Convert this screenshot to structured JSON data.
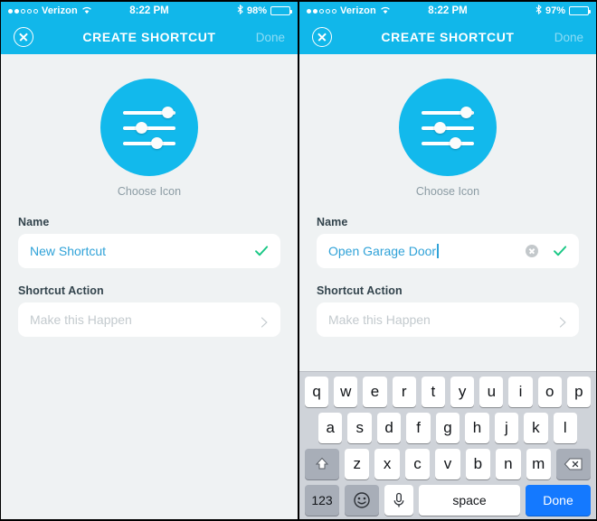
{
  "screens": [
    {
      "id": "left",
      "statusbar": {
        "signal_filled": 2,
        "signal_empty": 3,
        "carrier": "Verizon",
        "wifi_icon": "wifi-icon",
        "time": "8:22 PM",
        "bluetooth_icon": "bluetooth-icon",
        "battery_pct": "98%",
        "battery_level": 97
      },
      "navbar": {
        "close_icon": "close-circle-icon",
        "title": "CREATE SHORTCUT",
        "done_label": "Done"
      },
      "icon": {
        "choose_label": "Choose Icon",
        "circle_color": "#12b9ec",
        "slider_positions": [
          96,
          32,
          70
        ]
      },
      "name_field": {
        "label": "Name",
        "value": "New Shortcut",
        "placeholder": "Name",
        "show_clear": false,
        "show_caret": false,
        "check_icon": "checkmark-icon",
        "check_color": "#18c784",
        "value_color": "#2fa2d8"
      },
      "action_field": {
        "label": "Shortcut Action",
        "placeholder": "Make this Happen",
        "chevron_icon": "chevron-right-icon"
      },
      "keyboard": {
        "visible": false
      }
    },
    {
      "id": "right",
      "statusbar": {
        "signal_filled": 2,
        "signal_empty": 3,
        "carrier": "Verizon",
        "wifi_icon": "wifi-icon",
        "time": "8:22 PM",
        "bluetooth_icon": "bluetooth-icon",
        "battery_pct": "97%",
        "battery_level": 95
      },
      "navbar": {
        "close_icon": "close-circle-icon",
        "title": "CREATE SHORTCUT",
        "done_label": "Done"
      },
      "icon": {
        "choose_label": "Choose Icon",
        "circle_color": "#12b9ec",
        "slider_positions": [
          96,
          32,
          70
        ]
      },
      "name_field": {
        "label": "Name",
        "value": "Open Garage Door",
        "placeholder": "Name",
        "show_clear": true,
        "show_caret": true,
        "clear_icon": "clear-text-icon",
        "check_icon": "checkmark-icon",
        "check_color": "#18c784",
        "value_color": "#2fa2d8"
      },
      "action_field": {
        "label": "Shortcut Action",
        "placeholder": "Make this Happen",
        "chevron_icon": "chevron-right-icon"
      },
      "keyboard": {
        "visible": true,
        "row1": [
          "q",
          "w",
          "e",
          "r",
          "t",
          "y",
          "u",
          "i",
          "o",
          "p"
        ],
        "row2": [
          "a",
          "s",
          "d",
          "f",
          "g",
          "h",
          "j",
          "k",
          "l"
        ],
        "row3": [
          "z",
          "x",
          "c",
          "v",
          "b",
          "n",
          "m"
        ],
        "shift_icon": "shift-arrow-icon",
        "delete_icon": "backspace-icon",
        "numbers_label": "123",
        "emoji_icon": "smiley-icon",
        "mic_icon": "microphone-icon",
        "space_label": "space",
        "done_label": "Done",
        "done_color": "#1479ff"
      }
    }
  ]
}
